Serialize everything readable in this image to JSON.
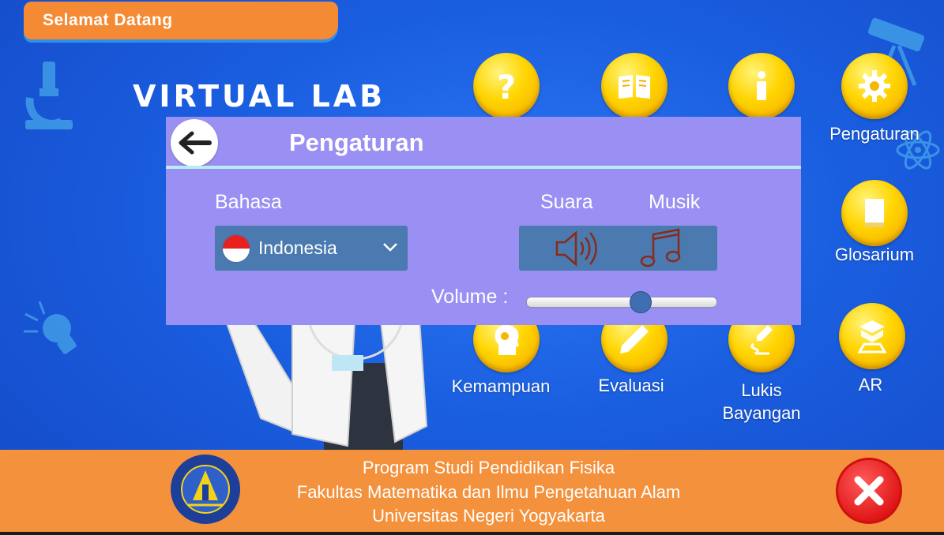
{
  "header": {
    "welcome_text": "Selamat Datang",
    "app_title": "VIRTUAL LAB"
  },
  "menu": {
    "items": [
      {
        "name": "help",
        "label": "",
        "icon": "question-icon"
      },
      {
        "name": "guide",
        "label": "",
        "icon": "book-icon"
      },
      {
        "name": "info",
        "label": "",
        "icon": "info-icon"
      },
      {
        "name": "settings",
        "label": "Pengaturan",
        "icon": "gear-icon"
      },
      {
        "name": "glossary",
        "label": "Glosarium",
        "icon": "glossary-book-icon"
      },
      {
        "name": "ability",
        "label": "Kemampuan",
        "icon": "head-gears-icon"
      },
      {
        "name": "evaluation",
        "label": "Evaluasi",
        "icon": "pencil-icon"
      },
      {
        "name": "drawing",
        "label": "Lukis Bayangan",
        "label_line1": "Lukis",
        "label_line2": "Bayangan",
        "icon": "drawing-icon"
      },
      {
        "name": "ar",
        "label": "AR",
        "icon": "ar-cube-icon"
      }
    ]
  },
  "settings_panel": {
    "title": "Pengaturan",
    "back_icon": "back-arrow-icon",
    "language": {
      "label": "Bahasa",
      "selected": "Indonesia",
      "flag_icon": "indonesia-flag-icon"
    },
    "sound": {
      "label": "Suara",
      "icon": "speaker-icon"
    },
    "music": {
      "label": "Musik",
      "icon": "music-note-icon"
    },
    "volume": {
      "label": "Volume :",
      "value": 0.6
    }
  },
  "footer": {
    "line1": "Program Studi Pendidikan Fisika",
    "line2": "Fakultas Matematika dan Ilmu Pengetahuan Alam",
    "line3": "Universitas Negeri Yogyakarta",
    "logo_icon": "uny-logo-icon",
    "logo_text": "UNIVERSITAS NEGERI YOGYAKARTA",
    "close_icon": "close-icon"
  },
  "colors": {
    "background": "#1a5ee0",
    "panel": "#9a8ff2",
    "footer": "#f4913c",
    "menu_button": "#ffd400",
    "close_button": "#e01818"
  }
}
